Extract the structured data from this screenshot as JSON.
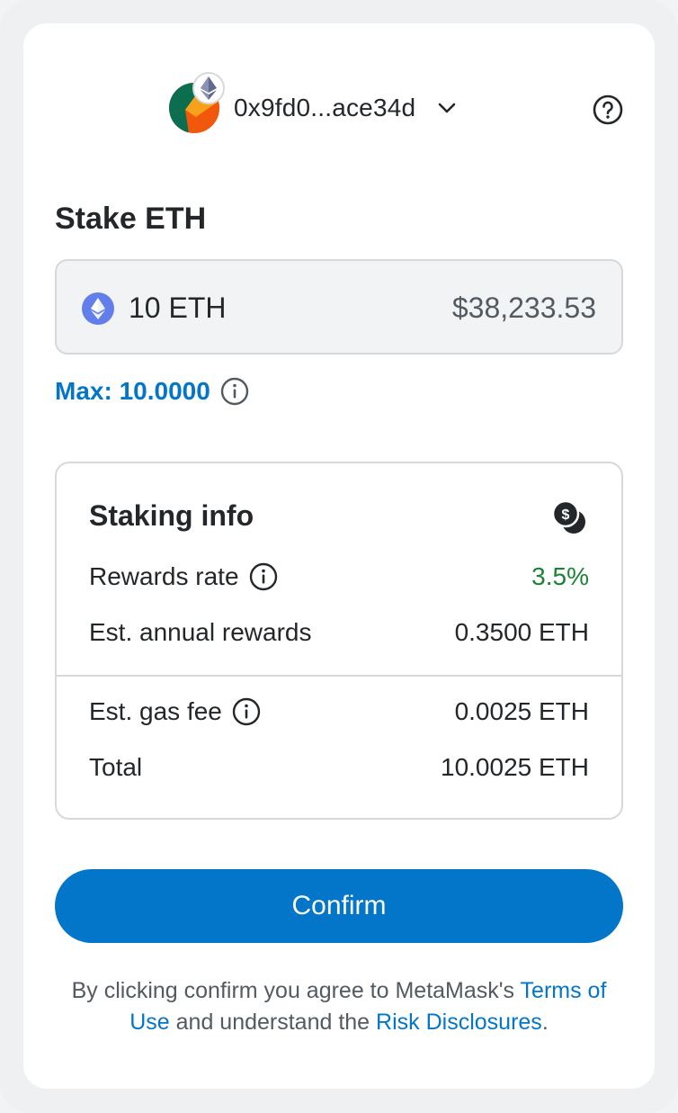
{
  "header": {
    "account_address": "0x9fd0...ace34d",
    "avatar_icon": "account-avatar-icon",
    "network_icon": "ethereum-icon",
    "dropdown_icon": "chevron-down-icon",
    "help_icon": "question-circle-icon"
  },
  "stake": {
    "title": "Stake ETH",
    "amount": "10 ETH",
    "fiat_value": "$38,233.53",
    "token_icon": "ethereum-icon",
    "max_label": "Max: 10.0000"
  },
  "staking_info": {
    "title": "Staking info",
    "icon": "coins-icon",
    "rows": [
      {
        "label": "Rewards rate",
        "value": "3.5%",
        "has_info": true
      },
      {
        "label": "Est. annual rewards",
        "value": "0.3500 ETH",
        "has_info": false
      },
      {
        "label": "Est. gas fee",
        "value": "0.0025 ETH",
        "has_info": true
      },
      {
        "label": "Total",
        "value": "10.0025 ETH",
        "has_info": false
      }
    ]
  },
  "confirm_label": "Confirm",
  "legal": {
    "prefix": "By clicking confirm you agree to MetaMask's ",
    "terms_link": "Terms of Use",
    "middle": " and understand the ",
    "risk_link": "Risk Disclosures",
    "suffix": "."
  },
  "colors": {
    "accent": "#0376c9",
    "positive": "#1c8234",
    "eth": "#627eea"
  }
}
